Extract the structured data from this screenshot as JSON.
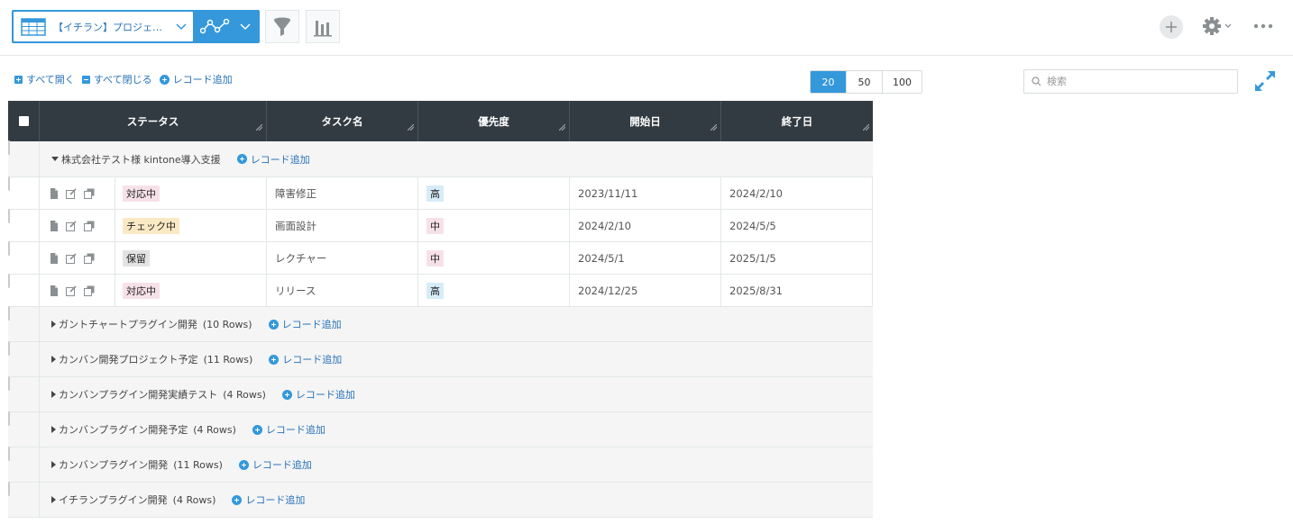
{
  "header": {
    "view_label": "【イチラン】プロジェ…",
    "colors": {
      "accent": "#3498db",
      "header_bg": "#333b42"
    }
  },
  "toolbar": {
    "expand_all": "すべて開く",
    "collapse_all": "すべて閉じる",
    "add_record": "レコード追加",
    "page_sizes": [
      "20",
      "50",
      "100"
    ],
    "selected_page_size": "20",
    "search_placeholder": "検索"
  },
  "table": {
    "columns": [
      "ステータス",
      "タスク名",
      "優先度",
      "開始日",
      "終了日"
    ],
    "groups": [
      {
        "name": "株式会社テスト様 kintone導入支援",
        "count": "",
        "expanded": true,
        "add_label": "レコード追加",
        "rows": [
          {
            "status": "対応中",
            "status_color": "#f7e1e8",
            "task": "障害修正",
            "priority": "高",
            "priority_color": "#d6ecf7",
            "start": "2023/11/11",
            "end": "2024/2/10"
          },
          {
            "status": "チェック中",
            "status_color": "#fbe9c4",
            "task": "画面設計",
            "priority": "中",
            "priority_color": "#f7e1e8",
            "start": "2024/2/10",
            "end": "2024/5/5"
          },
          {
            "status": "保留",
            "status_color": "#e3e3e3",
            "task": "レクチャー",
            "priority": "中",
            "priority_color": "#f7e1e8",
            "start": "2024/5/1",
            "end": "2025/1/5"
          },
          {
            "status": "対応中",
            "status_color": "#f7e1e8",
            "task": "リリース",
            "priority": "高",
            "priority_color": "#d6ecf7",
            "start": "2024/12/25",
            "end": "2025/8/31"
          }
        ]
      },
      {
        "name": "ガントチャートプラグイン開発",
        "count": "(10 Rows)",
        "expanded": false,
        "add_label": "レコード追加",
        "rows": []
      },
      {
        "name": "カンバン開発プロジェクト予定",
        "count": "(11 Rows)",
        "expanded": false,
        "add_label": "レコード追加",
        "rows": []
      },
      {
        "name": "カンバンプラグイン開発実績テスト",
        "count": "(4 Rows)",
        "expanded": false,
        "add_label": "レコード追加",
        "rows": []
      },
      {
        "name": "カンバンプラグイン開発予定",
        "count": "(4 Rows)",
        "expanded": false,
        "add_label": "レコード追加",
        "rows": []
      },
      {
        "name": "カンバンプラグイン開発",
        "count": "(11 Rows)",
        "expanded": false,
        "add_label": "レコード追加",
        "rows": []
      },
      {
        "name": "イチランプラグイン開発",
        "count": "(4 Rows)",
        "expanded": false,
        "add_label": "レコード追加",
        "rows": []
      }
    ]
  }
}
